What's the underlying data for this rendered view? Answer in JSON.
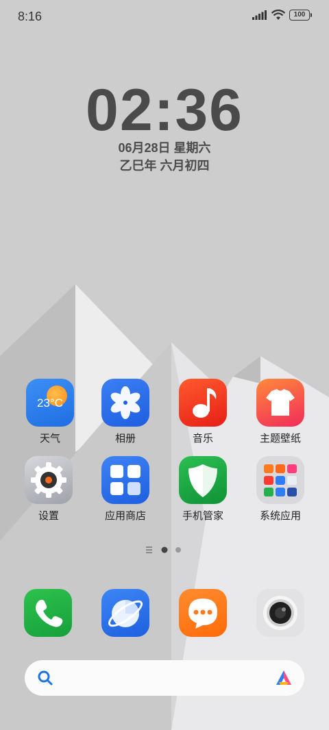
{
  "status_bar": {
    "time": "8:16",
    "battery": "100",
    "icons": [
      "signal-icon",
      "wifi-icon",
      "battery-icon"
    ]
  },
  "lock_clock": {
    "time": "02:36",
    "date": "06月28日 星期六",
    "lunar": "乙巳年 六月初四"
  },
  "weather": {
    "temperature": "23°C"
  },
  "apps": [
    {
      "label": "天气",
      "icon": "weather-icon"
    },
    {
      "label": "相册",
      "icon": "gallery-icon"
    },
    {
      "label": "音乐",
      "icon": "music-icon"
    },
    {
      "label": "主题壁纸",
      "icon": "theme-icon"
    },
    {
      "label": "设置",
      "icon": "settings-icon"
    },
    {
      "label": "应用商店",
      "icon": "app-store-icon"
    },
    {
      "label": "手机管家",
      "icon": "security-icon"
    },
    {
      "label": "系统应用",
      "icon": "folder-icon"
    }
  ],
  "page_indicator": {
    "pages": 2,
    "active": 1
  },
  "dock": [
    {
      "icon": "phone-icon"
    },
    {
      "icon": "browser-icon"
    },
    {
      "icon": "messages-icon"
    },
    {
      "icon": "camera-icon"
    }
  ],
  "search_bar": {
    "icon": "search-icon",
    "assistant_icon": "assistant-icon"
  },
  "colors": {
    "wallpaper": "#cfcfcf",
    "clock_text": "#4a4a4a",
    "weather": "#2f7df0",
    "music": "#f03a1f",
    "security": "#22a94a",
    "phone": "#23b33d",
    "messages": "#ff7a1a"
  }
}
